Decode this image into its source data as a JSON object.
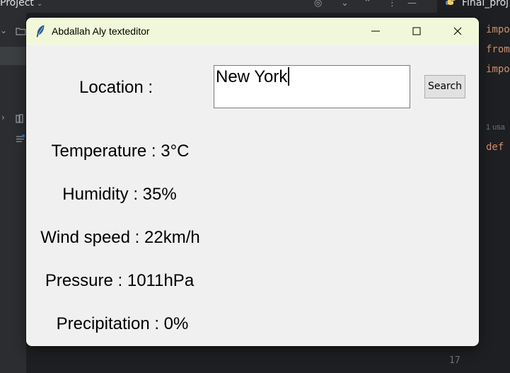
{
  "ide": {
    "project_label": "Project",
    "tab_label": "Final_proj",
    "code_lines": [
      "impo",
      "from",
      "impo",
      "",
      "1 usa",
      "def"
    ],
    "line_number": "17"
  },
  "window": {
    "title": "Abdallah Aly texteditor"
  },
  "form": {
    "location_label": "Location :",
    "location_value": "New York",
    "search_label": "Search"
  },
  "weather": {
    "temperature": "Temperature : 3°C",
    "humidity": "Humidity : 35%",
    "wind_speed": "Wind speed : 22km/h",
    "pressure": "Pressure : 1011hPa",
    "precipitation": "Precipitation : 0%"
  },
  "colors": {
    "titlebar_bg": "#f1f8d9",
    "window_bg": "#f0f0f0",
    "ide_bg": "#1e1f22",
    "keyword": "#cf8e6d"
  }
}
